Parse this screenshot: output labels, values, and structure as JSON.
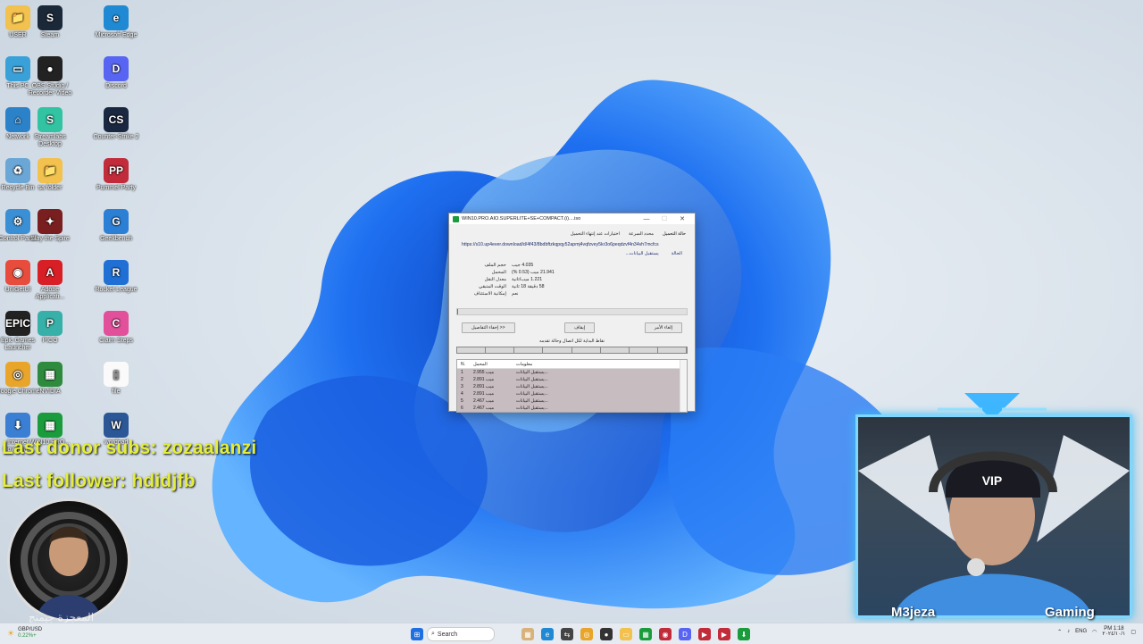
{
  "desktop_icons": [
    {
      "label": "USER",
      "color": "#f2c14e",
      "glyph": "📁"
    },
    {
      "label": "Steam",
      "color": "#1b2838",
      "glyph": "S"
    },
    {
      "label": "Microsoft Edge",
      "color": "#1f8ad3",
      "glyph": "e"
    },
    {
      "label": "This PC",
      "color": "#3aa1d8",
      "glyph": "▭"
    },
    {
      "label": "OBS Studio / Recorder Video",
      "color": "#222",
      "glyph": "●"
    },
    {
      "label": "Discord",
      "color": "#5865f2",
      "glyph": "D"
    },
    {
      "label": "Network",
      "color": "#2b82c9",
      "glyph": "⌂"
    },
    {
      "label": "Streamlabs Desktop",
      "color": "#31c3a2",
      "glyph": "S"
    },
    {
      "label": "Counter-Strike 2",
      "color": "#1a2740",
      "glyph": "CS"
    },
    {
      "label": "Recycle Bin",
      "color": "#6aa6d6",
      "glyph": "♻"
    },
    {
      "label": "sa folder",
      "color": "#f2c14e",
      "glyph": "📁"
    },
    {
      "label": "Pummel Party",
      "color": "#c22b3a",
      "glyph": "PP"
    },
    {
      "label": "Control Panel",
      "color": "#3b8fd4",
      "glyph": "⚙"
    },
    {
      "label": "Slay the Spire",
      "color": "#7a1f1f",
      "glyph": "✦"
    },
    {
      "label": "Geekbench",
      "color": "#2b7fd4",
      "glyph": "G"
    },
    {
      "label": "UniGetUI",
      "color": "#e84c3d",
      "glyph": "◉"
    },
    {
      "label": "Adobe Applicati...",
      "color": "#d81f26",
      "glyph": "A"
    },
    {
      "label": "Rocket League",
      "color": "#1f6fd4",
      "glyph": "R"
    },
    {
      "label": "Epic Games Launcher",
      "color": "#222",
      "glyph": "EPIC"
    },
    {
      "label": "PICO",
      "color": "#36b0a8",
      "glyph": "P"
    },
    {
      "label": "Claim Steps",
      "color": "#e24f9a",
      "glyph": "C"
    },
    {
      "label": "Google Chrome",
      "color": "#e8a52a",
      "glyph": "◎"
    },
    {
      "label": "NVIDIA",
      "color": "#2e8b3d",
      "glyph": "▦"
    },
    {
      "label": "file",
      "color": "#fafafa",
      "glyph": "▯"
    },
    {
      "label": "Internet Downloa...",
      "color": "#3a7fd4",
      "glyph": "⬇"
    },
    {
      "label": "WIN10.PRO...",
      "color": "#1a9c3d",
      "glyph": "▦"
    },
    {
      "label": "wordpad",
      "color": "#2b5797",
      "glyph": "W"
    }
  ],
  "overlay": {
    "donor": "Last donor subs: zozaalanzi",
    "follower": "Last follower: hdidjfb",
    "signature": "المعجزة جيمنج"
  },
  "idm": {
    "title": "WIN10.PRO.AIO.SUPERLITE+SE+COMPACT.(i)....iso",
    "tabs": [
      "حالة التحميل",
      "محدد السرعة",
      "اختيارات عند إنتهاء التحميل"
    ],
    "url": "https://s10.up4ever.download/d/4f43/8bdbftzkqpqy52apmj4vqfzvey5kr3o6peqdzvf4n34vh7mcfcs",
    "status_label": "الحالة",
    "status_value": "يستقبل البيانات...",
    "rows": [
      {
        "label": "حجم الملف",
        "value": "4.035 جيب"
      },
      {
        "label": "المحمل",
        "value": "21.941 ميب (0.53 %)"
      },
      {
        "label": "معدل النقل",
        "value": "1.221 ميب/ثانية"
      },
      {
        "label": "الوقت المتبقي",
        "value": "58 دقيقة 18 ثانية"
      },
      {
        "label": "إمكانية الاستئناف",
        "value": "نعم"
      }
    ],
    "progress_fraction": 0.0053,
    "buttons": {
      "details": "إخفاء التفاصيل >>",
      "pause": "إيقاف",
      "cancel": "إلغاء الأمر"
    },
    "segments_caption": "نقاط البداية لكل اتصال وحالة تقدمه",
    "table_headers": [
      "N.",
      "المحمل",
      "معلومات"
    ],
    "table_rows": [
      {
        "n": "1",
        "dl": "2.955 ميب",
        "info": "يستقبل البيانات..."
      },
      {
        "n": "2",
        "dl": "2.891 ميب",
        "info": "يستقبل البيانات..."
      },
      {
        "n": "3",
        "dl": "2.891 ميب",
        "info": "يستقبل البيانات..."
      },
      {
        "n": "4",
        "dl": "2.891 ميب",
        "info": "يستقبل البيانات..."
      },
      {
        "n": "5",
        "dl": "2.467 ميب",
        "info": "يستقبل البيانات..."
      },
      {
        "n": "6",
        "dl": "2.467 ميب",
        "info": "يستقبل البيانات..."
      }
    ]
  },
  "webcam": {
    "name": "M3jeza",
    "tag": "Gaming",
    "cap": "VIP"
  },
  "taskbar": {
    "weather_value": "GBP/USD",
    "weather_sub": "0.22%+",
    "search_placeholder": "Search",
    "lang": "ENG",
    "time": "PM 1:18",
    "date": "٢٠٢٤/١٠/١"
  }
}
